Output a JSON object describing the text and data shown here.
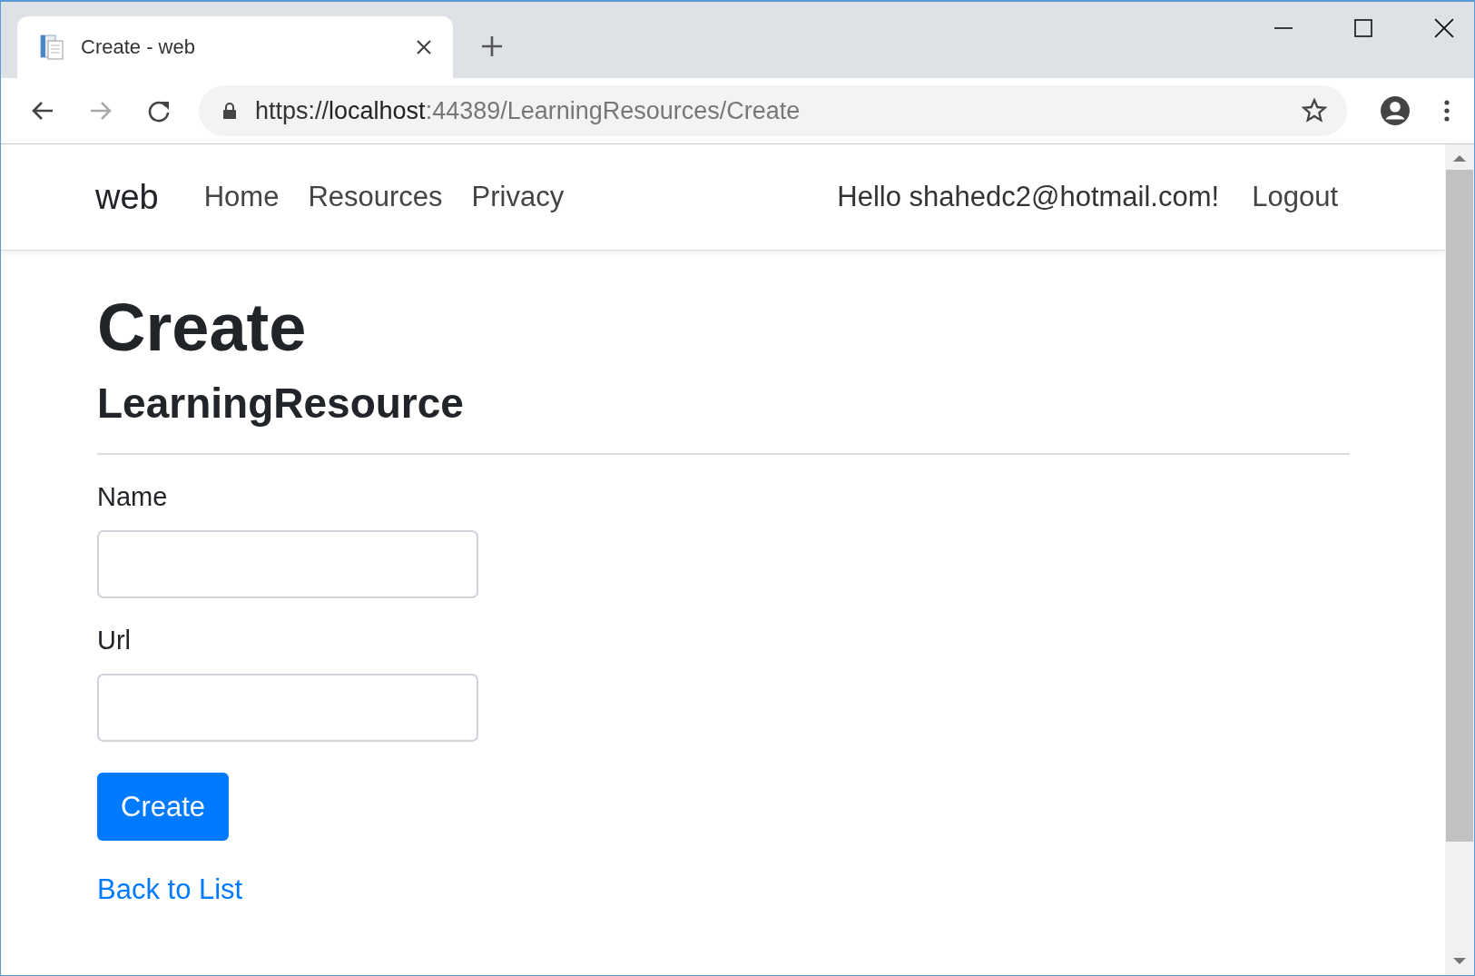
{
  "browser": {
    "tab": {
      "title": "Create - web"
    },
    "address": {
      "scheme": "https://",
      "host": "localhost",
      "rest": ":44389/LearningResources/Create"
    }
  },
  "navbar": {
    "brand": "web",
    "links": [
      "Home",
      "Resources",
      "Privacy"
    ],
    "greeting": "Hello shahedc2@hotmail.com!",
    "logout": "Logout"
  },
  "page": {
    "title": "Create",
    "subtitle": "LearningResource",
    "fields": [
      {
        "label": "Name"
      },
      {
        "label": "Url"
      }
    ],
    "submit": "Create",
    "back_link": "Back to List"
  }
}
